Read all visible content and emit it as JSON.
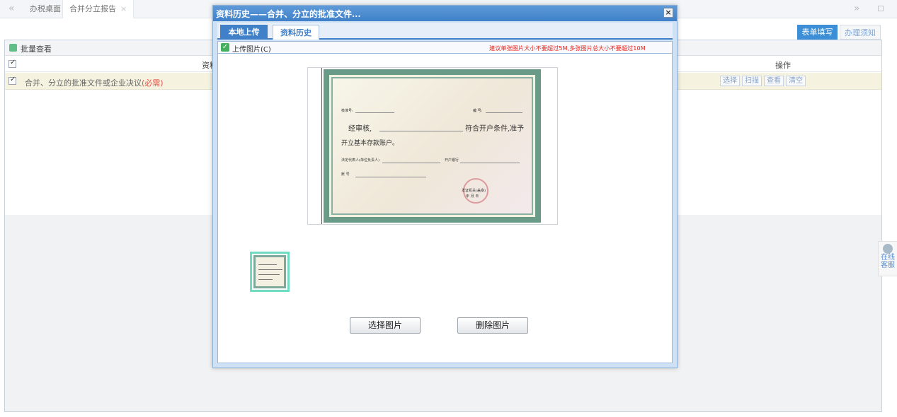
{
  "tabbar": {
    "nav_left": "«",
    "nav_right": "»",
    "tabs": [
      {
        "label": "办税桌面"
      },
      {
        "label": "合并分立报告",
        "close": "×"
      }
    ]
  },
  "form_tabs": {
    "active": "表单填写",
    "inactive": "办理须知"
  },
  "grid": {
    "batch_label": "批量查看",
    "col_material": "资料",
    "col_ops": "操作",
    "rows": [
      {
        "name": "合并、分立的批准文件或企业决议",
        "required": "(必需)",
        "ops": [
          "选择",
          "扫描",
          "查看",
          "清空"
        ]
      }
    ]
  },
  "service": {
    "line1": "在线",
    "line2": "客服"
  },
  "dialog": {
    "title": "资料历史——合并、分立的批准文件...",
    "close": "×",
    "tabs": {
      "local": "本地上传",
      "history": "资料历史"
    },
    "upload_label": "上传图片(C)",
    "warning": "建议单张图片大小不要超过5M,多张图片总大小不要超过10M",
    "buttons": {
      "select": "选择图片",
      "delete": "删除图片"
    },
    "certificate": {
      "key_no": "核准号:",
      "serial": "编 号:",
      "verified": "经审核,",
      "qualifies": "符合开户条件,准予",
      "open_acct": "开立基本存款账户。",
      "legal_rep": "法定代表人(单位负责人)",
      "bank": "开户银行",
      "account": "账 号",
      "issuer": "发证机关(盖章)",
      "date": "年 月 日"
    }
  }
}
